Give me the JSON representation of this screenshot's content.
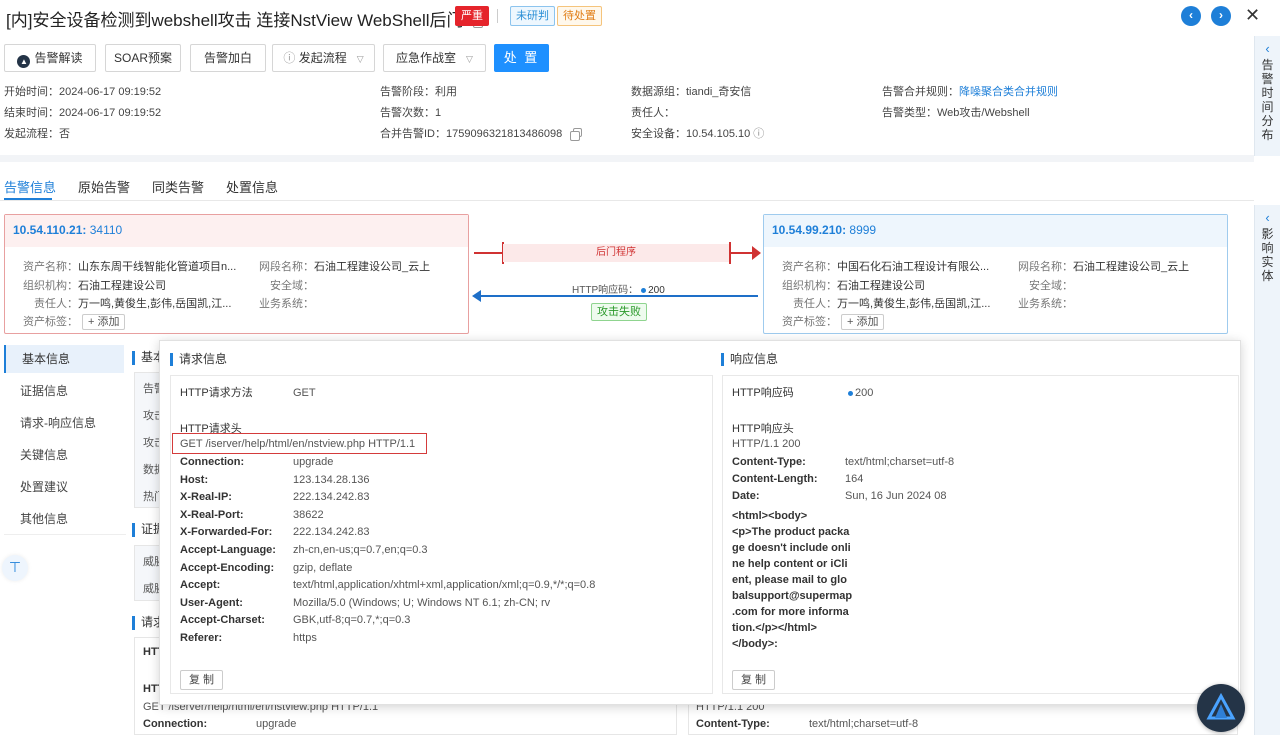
{
  "header": {
    "title": "[内]安全设备检测到webshell攻击 连接NstView WebShell后门",
    "badges": [
      "严重",
      "未研判",
      "待处置"
    ]
  },
  "toolbar": {
    "interpret": "告警解读",
    "soar": "SOAR预案",
    "whitelist": "告警加白",
    "flow": "发起流程",
    "war_room": "应急作战室",
    "handle": "处 置"
  },
  "meta": {
    "start": "开始时间：2024-06-17 09:19:52",
    "end": "结束时间：2024-06-17 09:19:52",
    "flow": "发起流程：否",
    "stage": "告警阶段：利用",
    "count": "告警次数：1",
    "merge_id_label": "合并告警ID：",
    "merge_id": "1759096321813486098",
    "source": "数据源组：tiandi_奇安信",
    "owner": "责任人：",
    "device": "安全设备：10.54.105.10",
    "merge_rule_label": "告警合并规则：",
    "merge_rule": "降噪聚合类合并规则",
    "type": "告警类型：Web攻击/Webshell"
  },
  "rails": {
    "top": "告警时间分布",
    "bottom": "影响实体"
  },
  "tabs": [
    "告警信息",
    "原始告警",
    "同类告警",
    "处置信息"
  ],
  "src": {
    "ip": "10.54.110.21:",
    "port": "34110",
    "asset_name_k": "资产名称：",
    "asset_name": "山东东周干线智能化管道项目n...",
    "org_k": "组织机构：",
    "org": "石油工程建设公司",
    "owner_k": "责任人：",
    "owner": "万一鸣,黄俊生,彭伟,岳国凯,江...",
    "tag_k": "资产标签：",
    "add": "+ 添加",
    "net_k": "网段名称：",
    "net": "石油工程建设公司_云上",
    "zone_k": "安全域：",
    "biz_k": "业务系统："
  },
  "dst": {
    "ip": "10.54.99.210:",
    "port": "8999",
    "asset_name_k": "资产名称：",
    "asset_name": "中国石化石油工程设计有限公...",
    "org_k": "组织机构：",
    "org": "石油工程建设公司",
    "owner_k": "责任人：",
    "owner": "万一鸣,黄俊生,彭伟,岳国凯,江...",
    "tag_k": "资产标签：",
    "add": "+ 添加",
    "net_k": "网段名称：",
    "net": "石油工程建设公司_云上",
    "zone_k": "安全域：",
    "biz_k": "业务系统："
  },
  "link": {
    "backdoor": "后门程序",
    "resp_label": "HTTP响应码：",
    "resp_code": "200",
    "result": "攻击失败"
  },
  "left_nav": [
    "基本信息",
    "证据信息",
    "请求-响应信息",
    "关键信息",
    "处置建议",
    "其他信息"
  ],
  "background": {
    "sec1": "基本",
    "sec1_rows": [
      "告警",
      "攻击",
      "攻击",
      "数据",
      "热门"
    ],
    "sec2": "证据",
    "sec2_rows": [
      "威胁",
      "威胁"
    ],
    "sec3": "请求",
    "left_line1": "HTT",
    "left_line2": "HTT",
    "left_req": "GET /iserver/help/html/en/nstview.php HTTP/1.1",
    "left_conn_k": "Connection:",
    "left_conn_v": "upgrade",
    "right_status": "HTTP/1.1 200",
    "right_ct_k": "Content-Type:",
    "right_ct_v": "text/html;charset=utf-8"
  },
  "request": {
    "title": "请求信息",
    "method_k": "HTTP请求方法",
    "method_v": "GET",
    "headers_title": "HTTP请求头",
    "request_line": "GET /iserver/help/html/en/nstview.php HTTP/1.1",
    "headers": [
      {
        "k": "Connection:",
        "v": "upgrade"
      },
      {
        "k": "Host:",
        "v": "123.134.28.136"
      },
      {
        "k": "X-Real-IP:",
        "v": "222.134.242.83"
      },
      {
        "k": "X-Real-Port:",
        "v": "38622"
      },
      {
        "k": "X-Forwarded-For:",
        "v": "222.134.242.83"
      },
      {
        "k": "Accept-Language:",
        "v": "zh-cn,en-us;q=0.7,en;q=0.3"
      },
      {
        "k": "Accept-Encoding:",
        "v": "gzip, deflate"
      },
      {
        "k": "Accept:",
        "v": "text/html,application/xhtml+xml,application/xml;q=0.9,*/*;q=0.8"
      },
      {
        "k": "User-Agent:",
        "v": "Mozilla/5.0 (Windows; U; Windows NT 6.1; zh-CN; rv"
      },
      {
        "k": "Accept-Charset:",
        "v": "GBK,utf-8;q=0.7,*;q=0.3"
      },
      {
        "k": "Referer:",
        "v": "https"
      }
    ],
    "copy": "复 制"
  },
  "response": {
    "title": "响应信息",
    "code_k": "HTTP响应码",
    "code_v": "200",
    "headers_title": "HTTP响应头",
    "status_line": "HTTP/1.1 200",
    "headers": [
      {
        "k": "Content-Type:",
        "v": "text/html;charset=utf-8"
      },
      {
        "k": "Content-Length:",
        "v": "164"
      },
      {
        "k": "Date:",
        "v": "Sun, 16 Jun 2024 08"
      }
    ],
    "body_lines": [
      "<html><body>",
      "<p>The product packa",
      "ge doesn't include onli",
      "ne help content or iCli",
      "ent, please mail to glo",
      "balsupport@supermap",
      ".com for more informa",
      "tion.</p></html>",
      "</body>:"
    ],
    "copy": "复 制"
  }
}
